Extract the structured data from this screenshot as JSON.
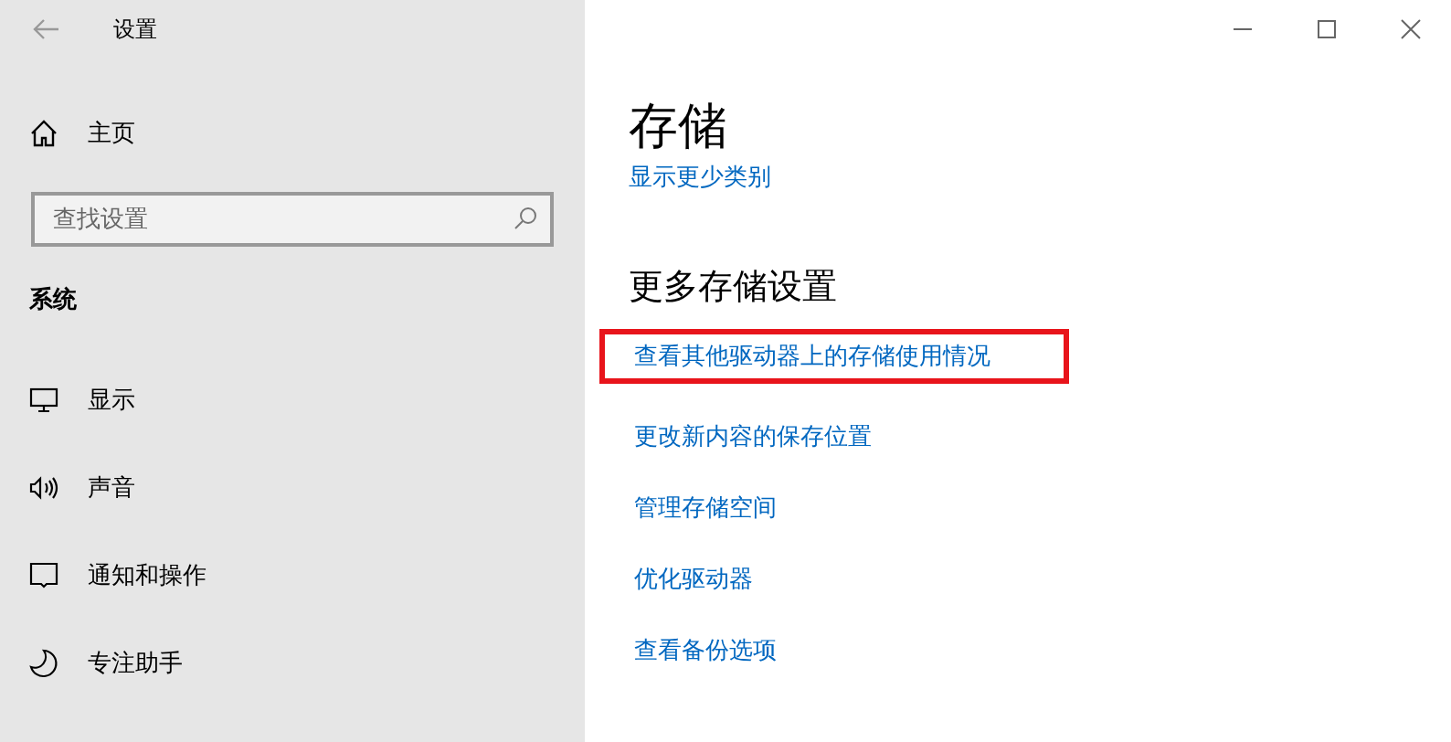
{
  "window": {
    "title": "设置"
  },
  "sidebar": {
    "home": "主页",
    "search": {
      "placeholder": "查找设置"
    },
    "section": "系统",
    "items": [
      {
        "label": "显示",
        "kind": "display"
      },
      {
        "label": "声音",
        "kind": "sound"
      },
      {
        "label": "通知和操作",
        "kind": "notify"
      },
      {
        "label": "专注助手",
        "kind": "focus"
      }
    ]
  },
  "page": {
    "title": "存储",
    "cut_link": "显示更少类别",
    "section": "更多存储设置",
    "links": [
      {
        "label": "查看其他驱动器上的存储使用情况",
        "highlighted": true
      },
      {
        "label": "更改新内容的保存位置",
        "highlighted": false
      },
      {
        "label": "管理存储空间",
        "highlighted": false
      },
      {
        "label": "优化驱动器",
        "highlighted": false
      },
      {
        "label": "查看备份选项",
        "highlighted": false
      }
    ]
  }
}
